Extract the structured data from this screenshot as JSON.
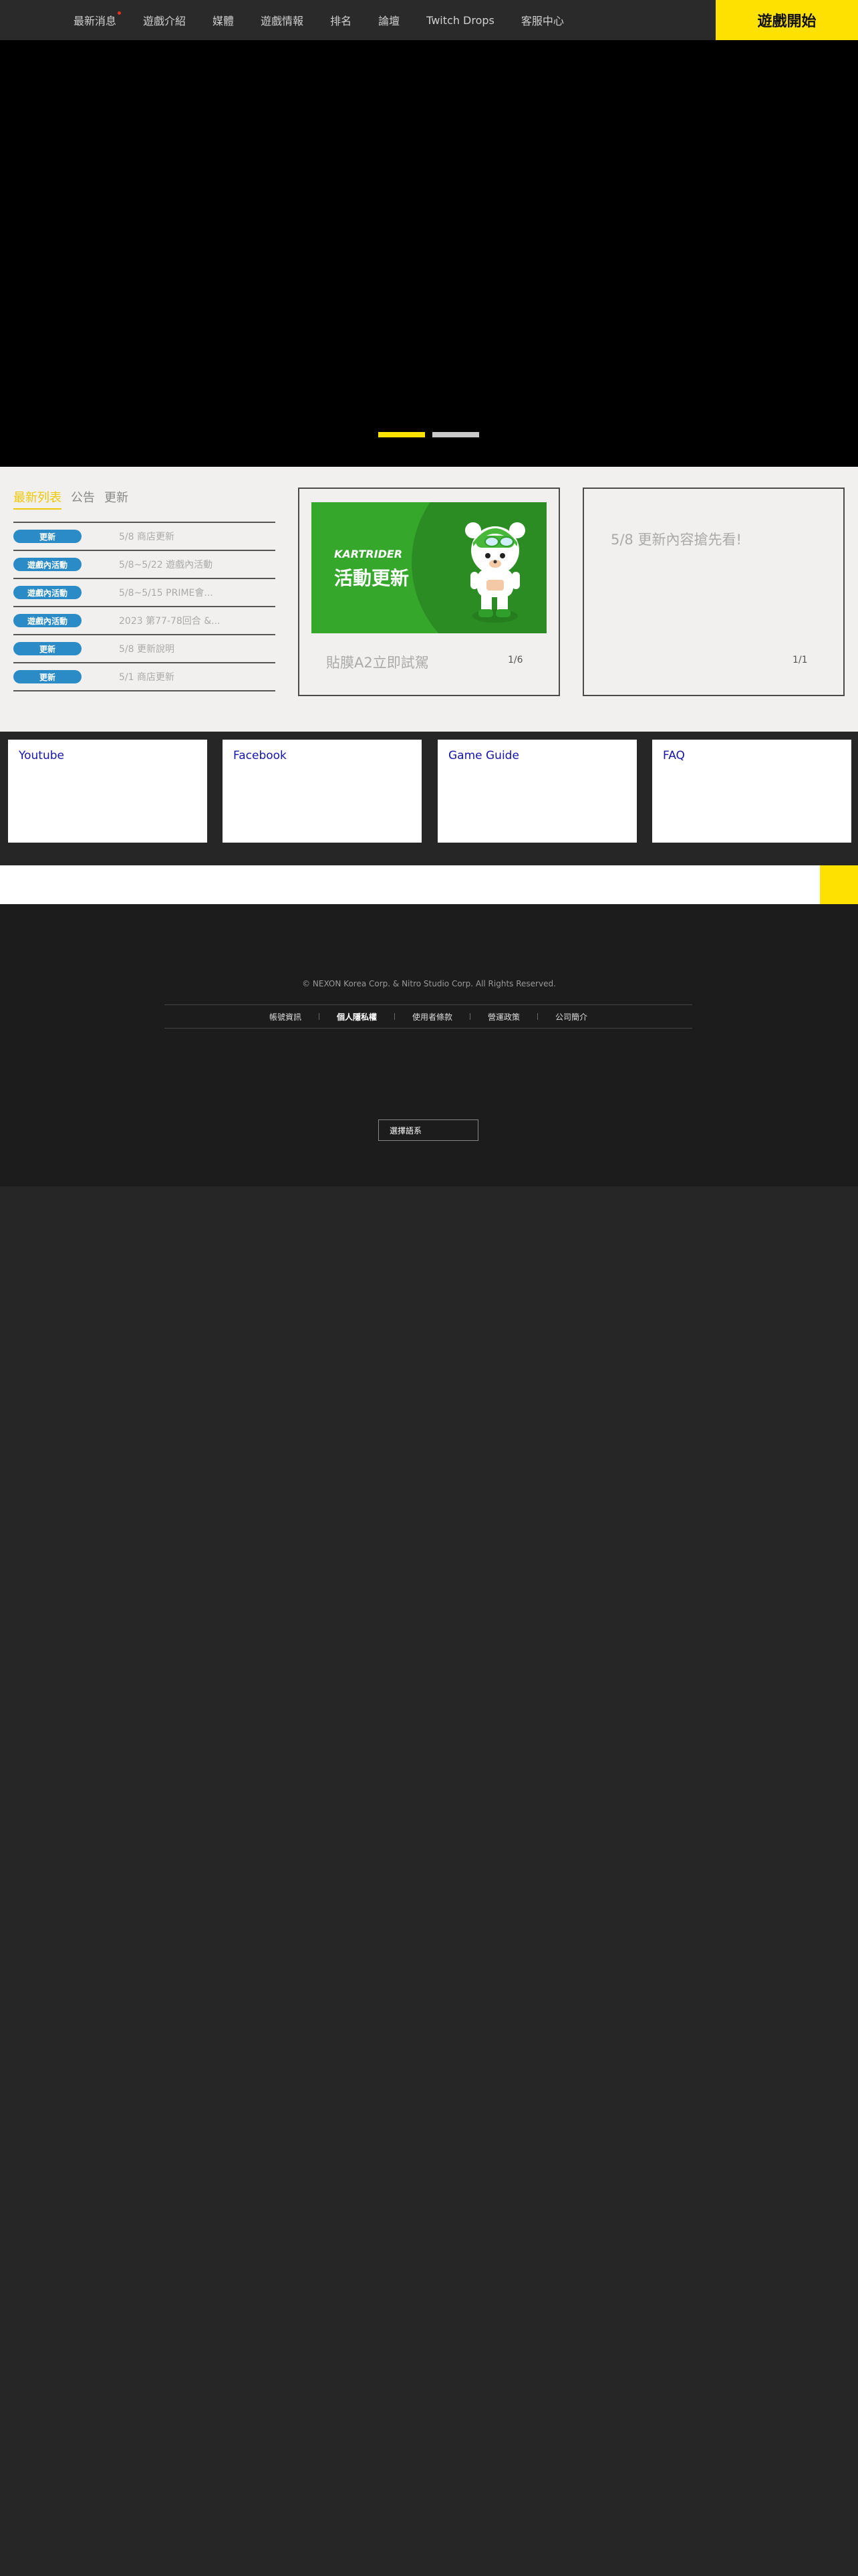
{
  "nav": {
    "items": [
      "最新消息",
      "遊戲介紹",
      "媒體",
      "遊戲情報",
      "排名",
      "論壇",
      "Twitch Drops",
      "客服中心"
    ],
    "start_label": "遊戲開始"
  },
  "hero": {
    "pager_count": 2,
    "active_page": 1,
    "pager_active_color": "#ffe100",
    "pager_inactive_color": "#c9c9c9"
  },
  "news": {
    "tabs": [
      "最新列表",
      "公告",
      "更新"
    ],
    "rows": [
      {
        "badge": "更新",
        "title": "5/8 商店更新"
      },
      {
        "badge": "遊戲內活動",
        "title": "5/8~5/22 遊戲內活動"
      },
      {
        "badge": "遊戲內活動",
        "title": "5/8~5/15 PRIME會..."
      },
      {
        "badge": "遊戲內活動",
        "title": "2023 第77-78回合 &..."
      },
      {
        "badge": "更新",
        "title": "5/8 更新說明"
      },
      {
        "badge": "更新",
        "title": "5/1 商店更新"
      }
    ],
    "badge_color": "#2a8bc7"
  },
  "featured": {
    "banner_brand": "KARTRIDER",
    "banner_text": "活動更新",
    "caption": "貼膜A2立即試駕",
    "page": "1/6"
  },
  "update_card": {
    "caption": "5/8 更新內容搶先看!",
    "page": "1/1"
  },
  "links": [
    "Youtube",
    "Facebook",
    "Game Guide",
    "FAQ"
  ],
  "footer": {
    "copyright": "© NEXON Korea Corp. & Nitro Studio Corp. All Rights Reserved.",
    "links": [
      "帳號資訊",
      "個人隱私權",
      "使用者條款",
      "營運政策",
      "公司簡介"
    ],
    "language_label": "選擇語系"
  },
  "colors": {
    "accent_yellow": "#ffe100",
    "link_blue": "#1515a8"
  }
}
